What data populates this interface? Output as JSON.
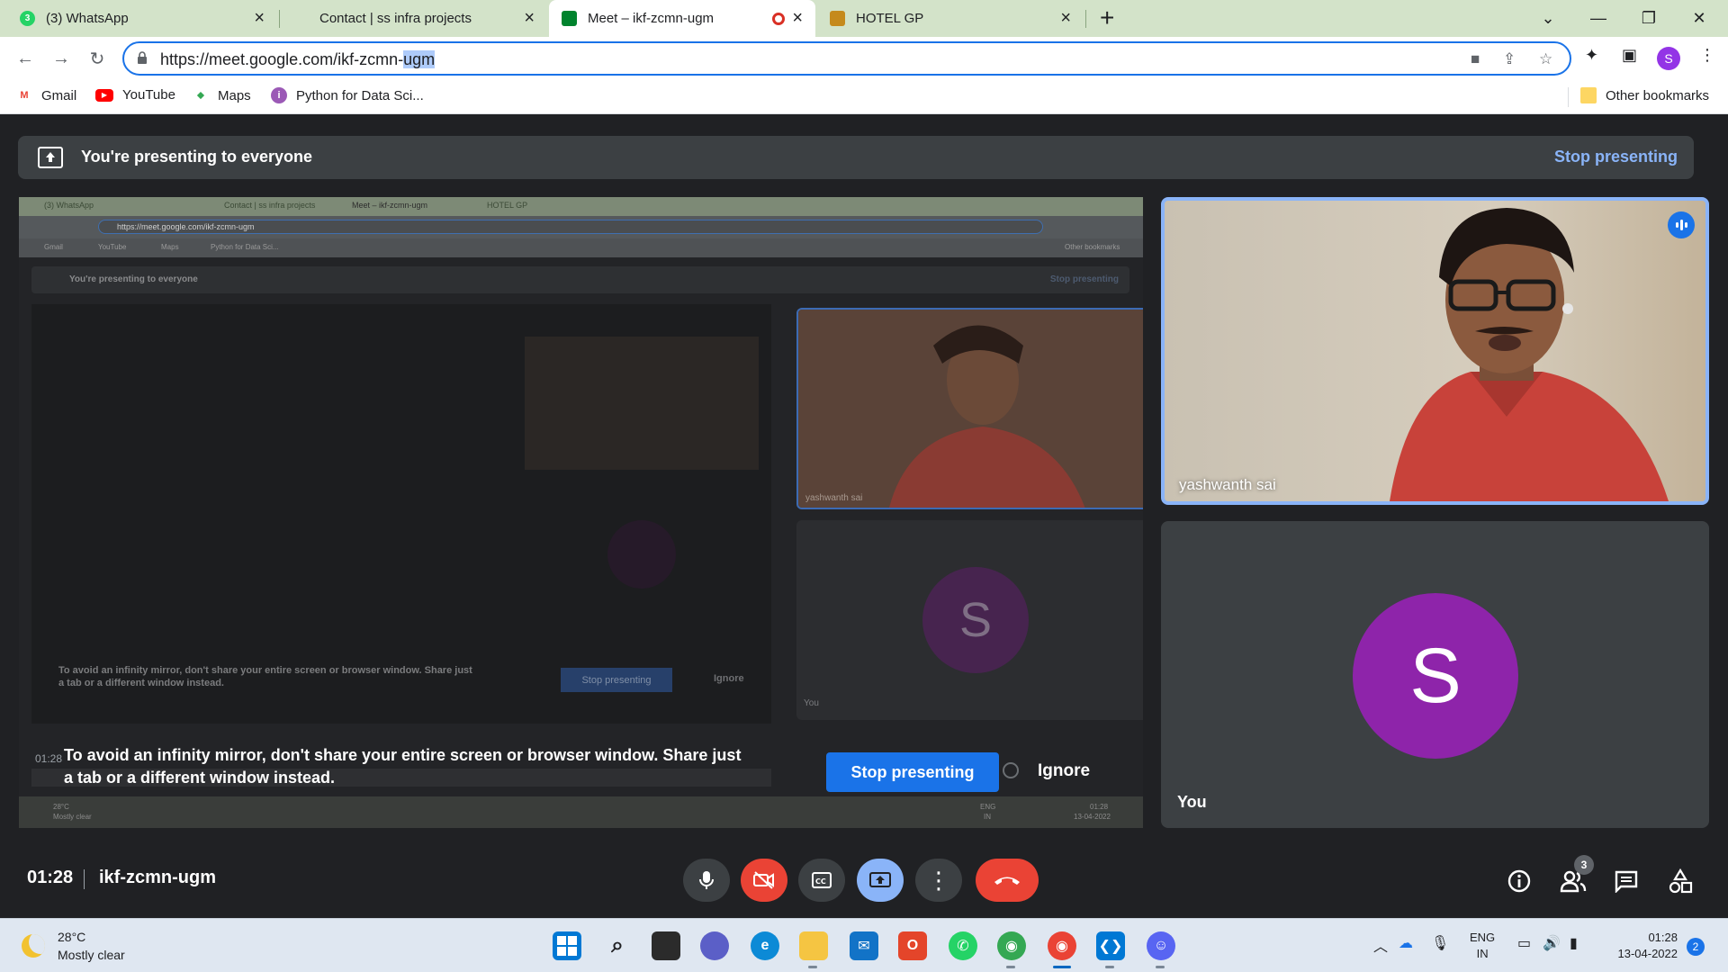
{
  "browser": {
    "tabs": [
      {
        "label": "(3) WhatsApp",
        "icon": "whatsapp-icon",
        "color": "#25d366",
        "badge": "3"
      },
      {
        "label": "Contact | ss infra projects",
        "icon": "page-icon",
        "color": "#d3e3c9",
        "badge": ""
      },
      {
        "label": "Meet – ikf-zcmn-ugm",
        "icon": "meet-icon",
        "color": "#00832d",
        "badge": ""
      },
      {
        "label": "HOTEL GP",
        "icon": "hotel-icon",
        "color": "#c58a1c",
        "badge": ""
      }
    ],
    "new_tab": "+",
    "url_main": "https://meet.google.com/ikf-zcmn-",
    "url_selected": "ugm",
    "profile_letter": "S",
    "bookmarks": [
      {
        "label": "Gmail",
        "icon": "gmail-icon"
      },
      {
        "label": "YouTube",
        "icon": "youtube-icon"
      },
      {
        "label": "Maps",
        "icon": "maps-icon"
      },
      {
        "label": "Python for Data Sci...",
        "icon": "python-icon"
      }
    ],
    "other_bookmarks": "Other bookmarks"
  },
  "meet": {
    "banner_text": "You're presenting to everyone",
    "banner_stop": "Stop presenting",
    "participant_name": "yashwanth sai",
    "you_label": "You",
    "you_letter": "S",
    "warning": "To avoid an infinity mirror, don't share your entire screen or browser window. Share just a tab or a different window instead.",
    "stop_button": "Stop presenting",
    "ignore_button": "Ignore",
    "time": "01:28",
    "meeting_code": "ikf-zcmn-ugm",
    "participant_count": "3",
    "nested": {
      "tabs": [
        "(3) WhatsApp",
        "Contact | ss infra projects",
        "Meet – ikf-zcmn-ugm",
        "HOTEL GP"
      ],
      "url": "https://meet.google.com/ikf-zcmn-ugm",
      "bookmarks": [
        "Gmail",
        "YouTube",
        "Maps",
        "Python for Data Sci...",
        "Other bookmarks"
      ],
      "banner_text": "You're presenting to everyone",
      "banner_stop": "Stop presenting",
      "participant_name": "yashwanth sai",
      "you_label": "You",
      "warning": "To avoid an infinity mirror, don't share your entire screen or browser window. Share just a tab or a different window instead.",
      "stop_button": "Stop presenting",
      "ignore_button": "Ignore",
      "time": "01:28",
      "weather_temp": "28°C",
      "weather_desc": "Mostly clear",
      "lang_1": "ENG",
      "lang_2": "IN",
      "clock_time": "01:28",
      "clock_date": "13-04-2022"
    }
  },
  "taskbar": {
    "weather_temp": "28°C",
    "weather_desc": "Mostly clear",
    "lang_1": "ENG",
    "lang_2": "IN",
    "time": "01:28",
    "date": "13-04-2022",
    "notifications": "2"
  },
  "colors": {
    "accent": "#1a73e8",
    "hangup": "#ea4335",
    "avatar": "#8e24aa",
    "meet_bg": "#202124"
  }
}
